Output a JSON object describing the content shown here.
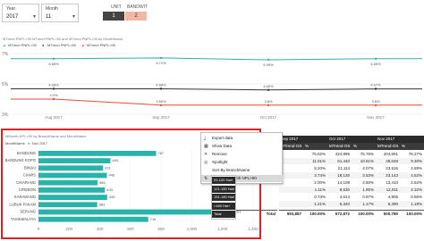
{
  "slicers": {
    "year": {
      "label": "Year",
      "value": "2017"
    },
    "month": {
      "label": "Month",
      "value": "11"
    }
  },
  "unit_toggle": {
    "unit_label": "UNIT",
    "bandwit_label": "BANDWIT",
    "unit_value": "1",
    "bandwit_value": "2",
    "bandwit_color": "#f4b6a6",
    "unit_color": "#444444"
  },
  "line_chart": {
    "title": "MTrend PNPL>90 MTrend PNPL>60 and MTrend PNPL>30 by MonthName",
    "legend": [
      "MTrend PNPL>30",
      "MTrend PNPL>60",
      "MTrend PNPL>90"
    ],
    "series_colors": [
      "#2ab3a8",
      "#333333",
      "#e84a3c"
    ],
    "y_ticks": [
      "7%",
      "5%",
      "3%"
    ],
    "x_ticks": [
      "Aug 2017",
      "Sep 2017",
      "Oct 2017",
      "Nov 2017"
    ],
    "series": [
      {
        "values": [
          6.66,
          6.71,
          6.59,
          6.66
        ],
        "labels": [
          "6.66%",
          "6.71%",
          "6.59%",
          "6.66%"
        ]
      },
      {
        "values": [
          4.68,
          4.68,
          4.6,
          4.67
        ],
        "labels": [
          "4.68%",
          "4.68%",
          "4.60%",
          "4.67%"
        ]
      },
      {
        "values": [
          4.0,
          3.6,
          3.6,
          3.6
        ],
        "labels": [
          "4.0%",
          "3.60%",
          "3.6%",
          "3.6%"
        ]
      }
    ]
  },
  "bar_chart": {
    "title": "MMonth NPL>90 by BranchName and MonthName",
    "legend_label": "MonthName",
    "legend_item": "Nov 2017",
    "bar_color": "#2ab3a8",
    "x_ticks": [
      "0",
      "200",
      "400",
      "600",
      "800",
      "1,000",
      "1,200",
      "1,400"
    ],
    "chart_data": {
      "type": "bar",
      "orientation": "horizontal",
      "categories": [
        "BANDUNG",
        "BANDUNG KOPO",
        "BINJAI",
        "CIAMIS",
        "CIKARANG",
        "CIREBON",
        "KARAWANG",
        "LUBUK PAKAM",
        "SERANG",
        "TASIKMALAYA"
      ],
      "values": [
        767,
        469,
        421,
        446,
        385,
        433,
        448,
        383,
        1251,
        716
      ],
      "labels": [
        "767",
        "469",
        "421",
        "446",
        "385",
        "433",
        "448",
        "383",
        "1,251",
        "716"
      ],
      "xlim": [
        0,
        1400
      ]
    }
  },
  "context_menu": {
    "items": [
      {
        "icon": "export-icon",
        "glyph": "⤓",
        "label": "Export data"
      },
      {
        "icon": "table-icon",
        "glyph": "▦",
        "label": "Show Data"
      },
      {
        "icon": "close-icon",
        "glyph": "✕",
        "label": "Remove"
      },
      {
        "icon": "spotlight-icon",
        "glyph": "◎",
        "label": "Spotlight"
      },
      {
        "icon": "sort-icon",
        "glyph": "",
        "label": "Sort By BranchName"
      },
      {
        "icon": "sort-icon",
        "glyph": "⇅",
        "label": "Sort By MMonth NPL>90"
      }
    ],
    "highlight_index": 5
  },
  "sub_menu": {
    "items": [
      "91-120 Hari",
      "121-150 Hari",
      "151-180 Hari",
      ">180 Hari",
      "Total"
    ]
  },
  "table": {
    "month_headers": [
      "Sep 2017",
      "Oct 2017",
      "Nov 2017"
    ],
    "col_headers": [
      "MTrend-OS",
      "%",
      "MTrend-OS",
      "%",
      "MTrend-OS",
      "%"
    ],
    "rows": [
      [
        "",
        "75.02%",
        "424,995",
        "75.76%",
        "404,691",
        "76.27%"
      ],
      [
        "",
        "11.01%",
        "61,440",
        "10.61%",
        "48,048",
        "9.30%"
      ],
      [
        "",
        "5.20%",
        "21,114",
        "4.07%",
        "23,516",
        "4.59%"
      ],
      [
        "",
        "3.74%",
        "18,130",
        "3.53%",
        "23,143",
        "4.52%"
      ],
      [
        "",
        "2.00%",
        "14,108",
        "2.80%",
        "13,410",
        "2.62%"
      ],
      [
        "",
        "1.11%",
        "9,530",
        "1.85%",
        "12,011",
        "2.32%"
      ],
      [
        "",
        "0.73%",
        "4,614",
        "0.97%",
        "4,905",
        "0.96%"
      ],
      [
        "",
        "1.21%",
        "5,340",
        "1.17%",
        "6,390",
        "1.18%"
      ]
    ],
    "total_row": [
      "Total",
      "593,887",
      "100.00%",
      "572,872",
      "100.00%",
      "500,780",
      "100.00%"
    ]
  }
}
